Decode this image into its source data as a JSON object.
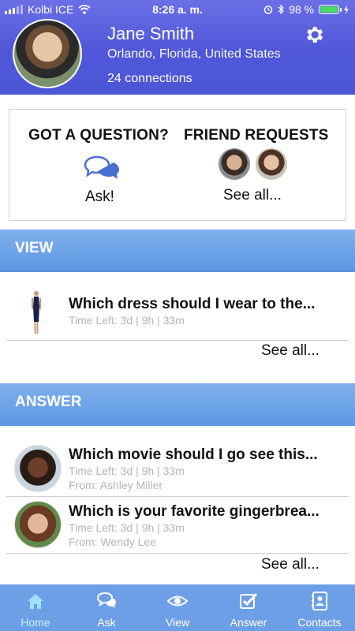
{
  "status_bar": {
    "carrier": "Kolbi ICE",
    "time": "8:26 a. m.",
    "battery_percent_text": "98 %",
    "battery_level": 0.98
  },
  "profile": {
    "name": "Jane Smith",
    "location": "Orlando, Florida, United States",
    "connections": "24 connections"
  },
  "question_card": {
    "title": "GOT A QUESTION?",
    "ask_label": "Ask!"
  },
  "friend_requests": {
    "title": "FRIEND REQUESTS",
    "see_all": "See all..."
  },
  "view_section": {
    "title": "VIEW",
    "items": [
      {
        "title": "Which dress should I wear to the...",
        "meta": "Time Left: 3d | 9h | 33m"
      }
    ],
    "see_all": "See all..."
  },
  "answer_section": {
    "title": "ANSWER",
    "items": [
      {
        "title": "Which movie should I go see this...",
        "meta": "Time Left: 3d | 9h | 33m",
        "from": "From: Ashley Miller"
      },
      {
        "title": "Which is your favorite gingerbrea...",
        "meta": "Time Left: 3d | 9h | 33m",
        "from": "From: Wendy Lee"
      }
    ],
    "see_all": "See all..."
  },
  "tabs": [
    {
      "label": "Home",
      "icon": "home-icon",
      "active": true
    },
    {
      "label": "Ask",
      "icon": "chat-icon",
      "active": false
    },
    {
      "label": "View",
      "icon": "eye-icon",
      "active": false
    },
    {
      "label": "Answer",
      "icon": "checkbox-icon",
      "active": false
    },
    {
      "label": "Contacts",
      "icon": "contact-card-icon",
      "active": false
    }
  ],
  "colors": {
    "header": "#4f57d8",
    "section_bar": "#6a9fe6",
    "tabbar": "#6d9fe6",
    "active_tab": "#c8f1ff",
    "battery": "#4cd964"
  }
}
